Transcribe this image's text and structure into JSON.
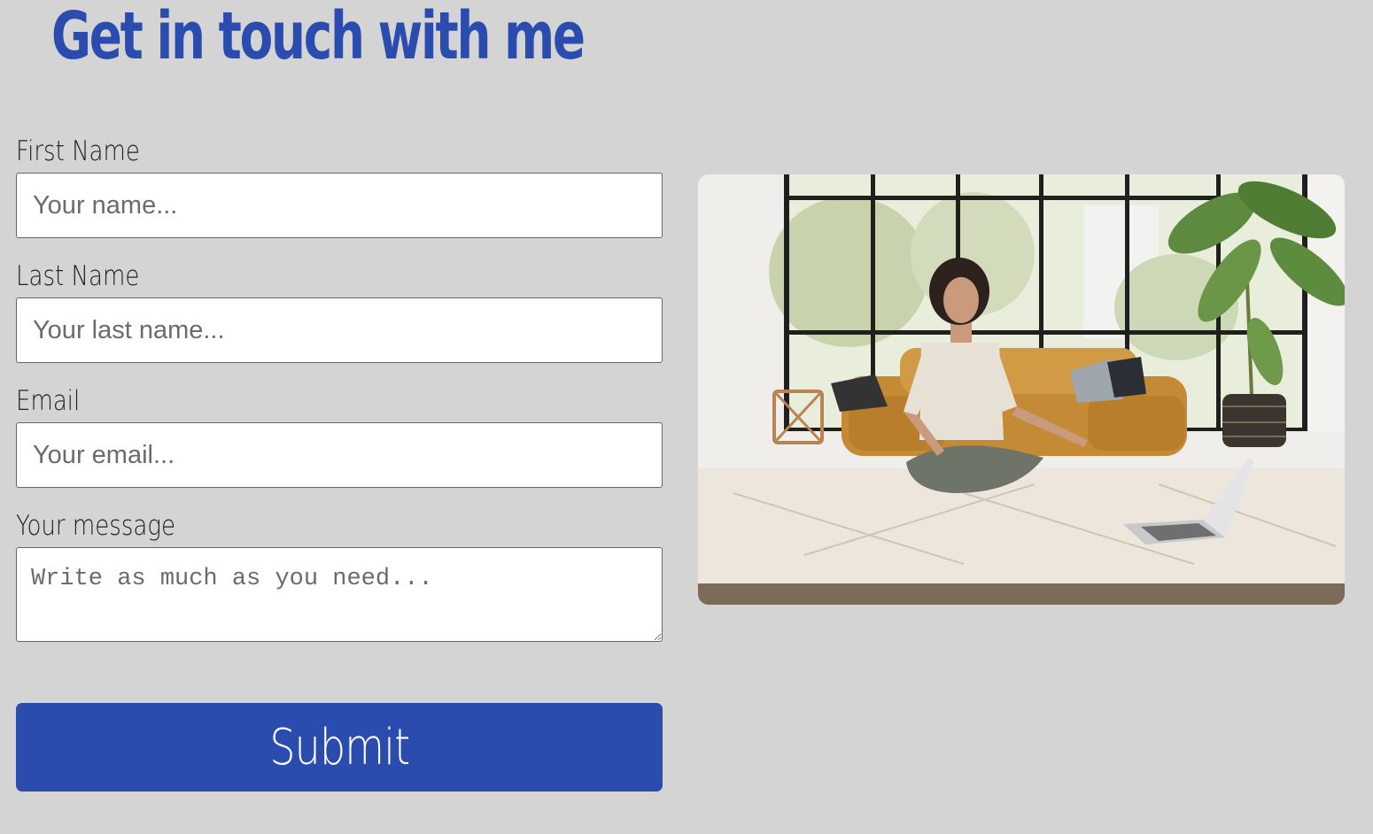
{
  "header": {
    "title": "Get in touch with me"
  },
  "form": {
    "first_name": {
      "label": "First Name",
      "placeholder": "Your name..."
    },
    "last_name": {
      "label": "Last Name",
      "placeholder": "Your last name..."
    },
    "email": {
      "label": "Email",
      "placeholder": "Your email..."
    },
    "message": {
      "label": "Your message",
      "placeholder": "Write as much as you need..."
    },
    "submit_label": "Submit"
  },
  "colors": {
    "background": "#d4d4d4",
    "accent": "#2a4caf",
    "input_background": "#ffffff"
  }
}
